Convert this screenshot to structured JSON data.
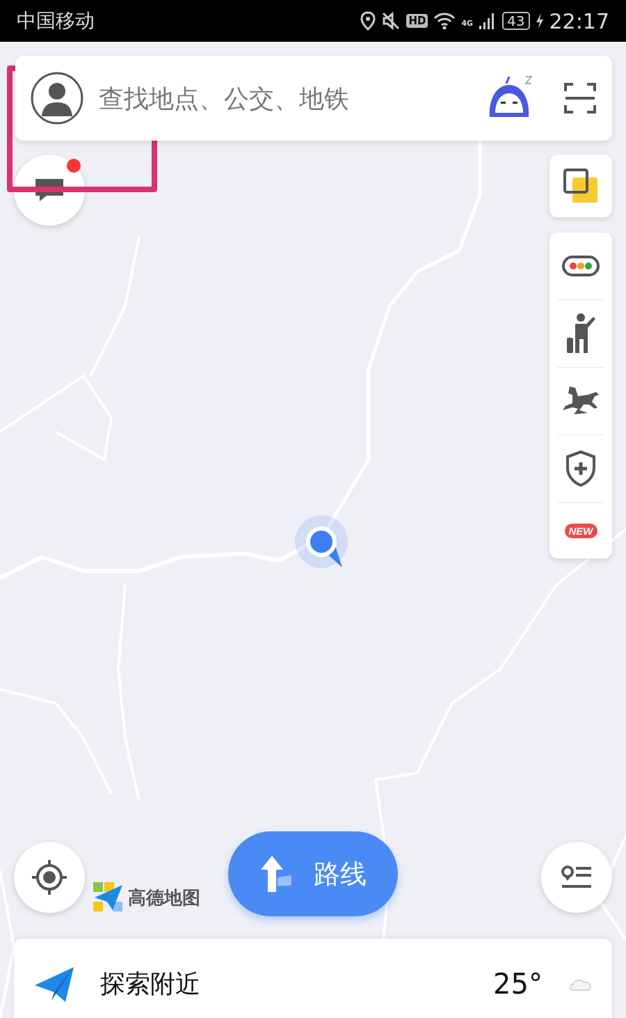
{
  "status_bar": {
    "carrier": "中国移动",
    "hd": "HD",
    "network": "4G",
    "battery": "43",
    "time": "22:17"
  },
  "search": {
    "placeholder": "查找地点、公交、地铁"
  },
  "messages": {
    "unread": true
  },
  "tools": [
    {
      "kind": "traffic"
    },
    {
      "kind": "taxi"
    },
    {
      "kind": "horse"
    },
    {
      "kind": "shield"
    },
    {
      "kind": "new",
      "label": "NEW"
    }
  ],
  "logo": "高德地图",
  "route_button": {
    "label": "路线"
  },
  "explore": {
    "label": "探索附近",
    "temperature": "25°"
  }
}
